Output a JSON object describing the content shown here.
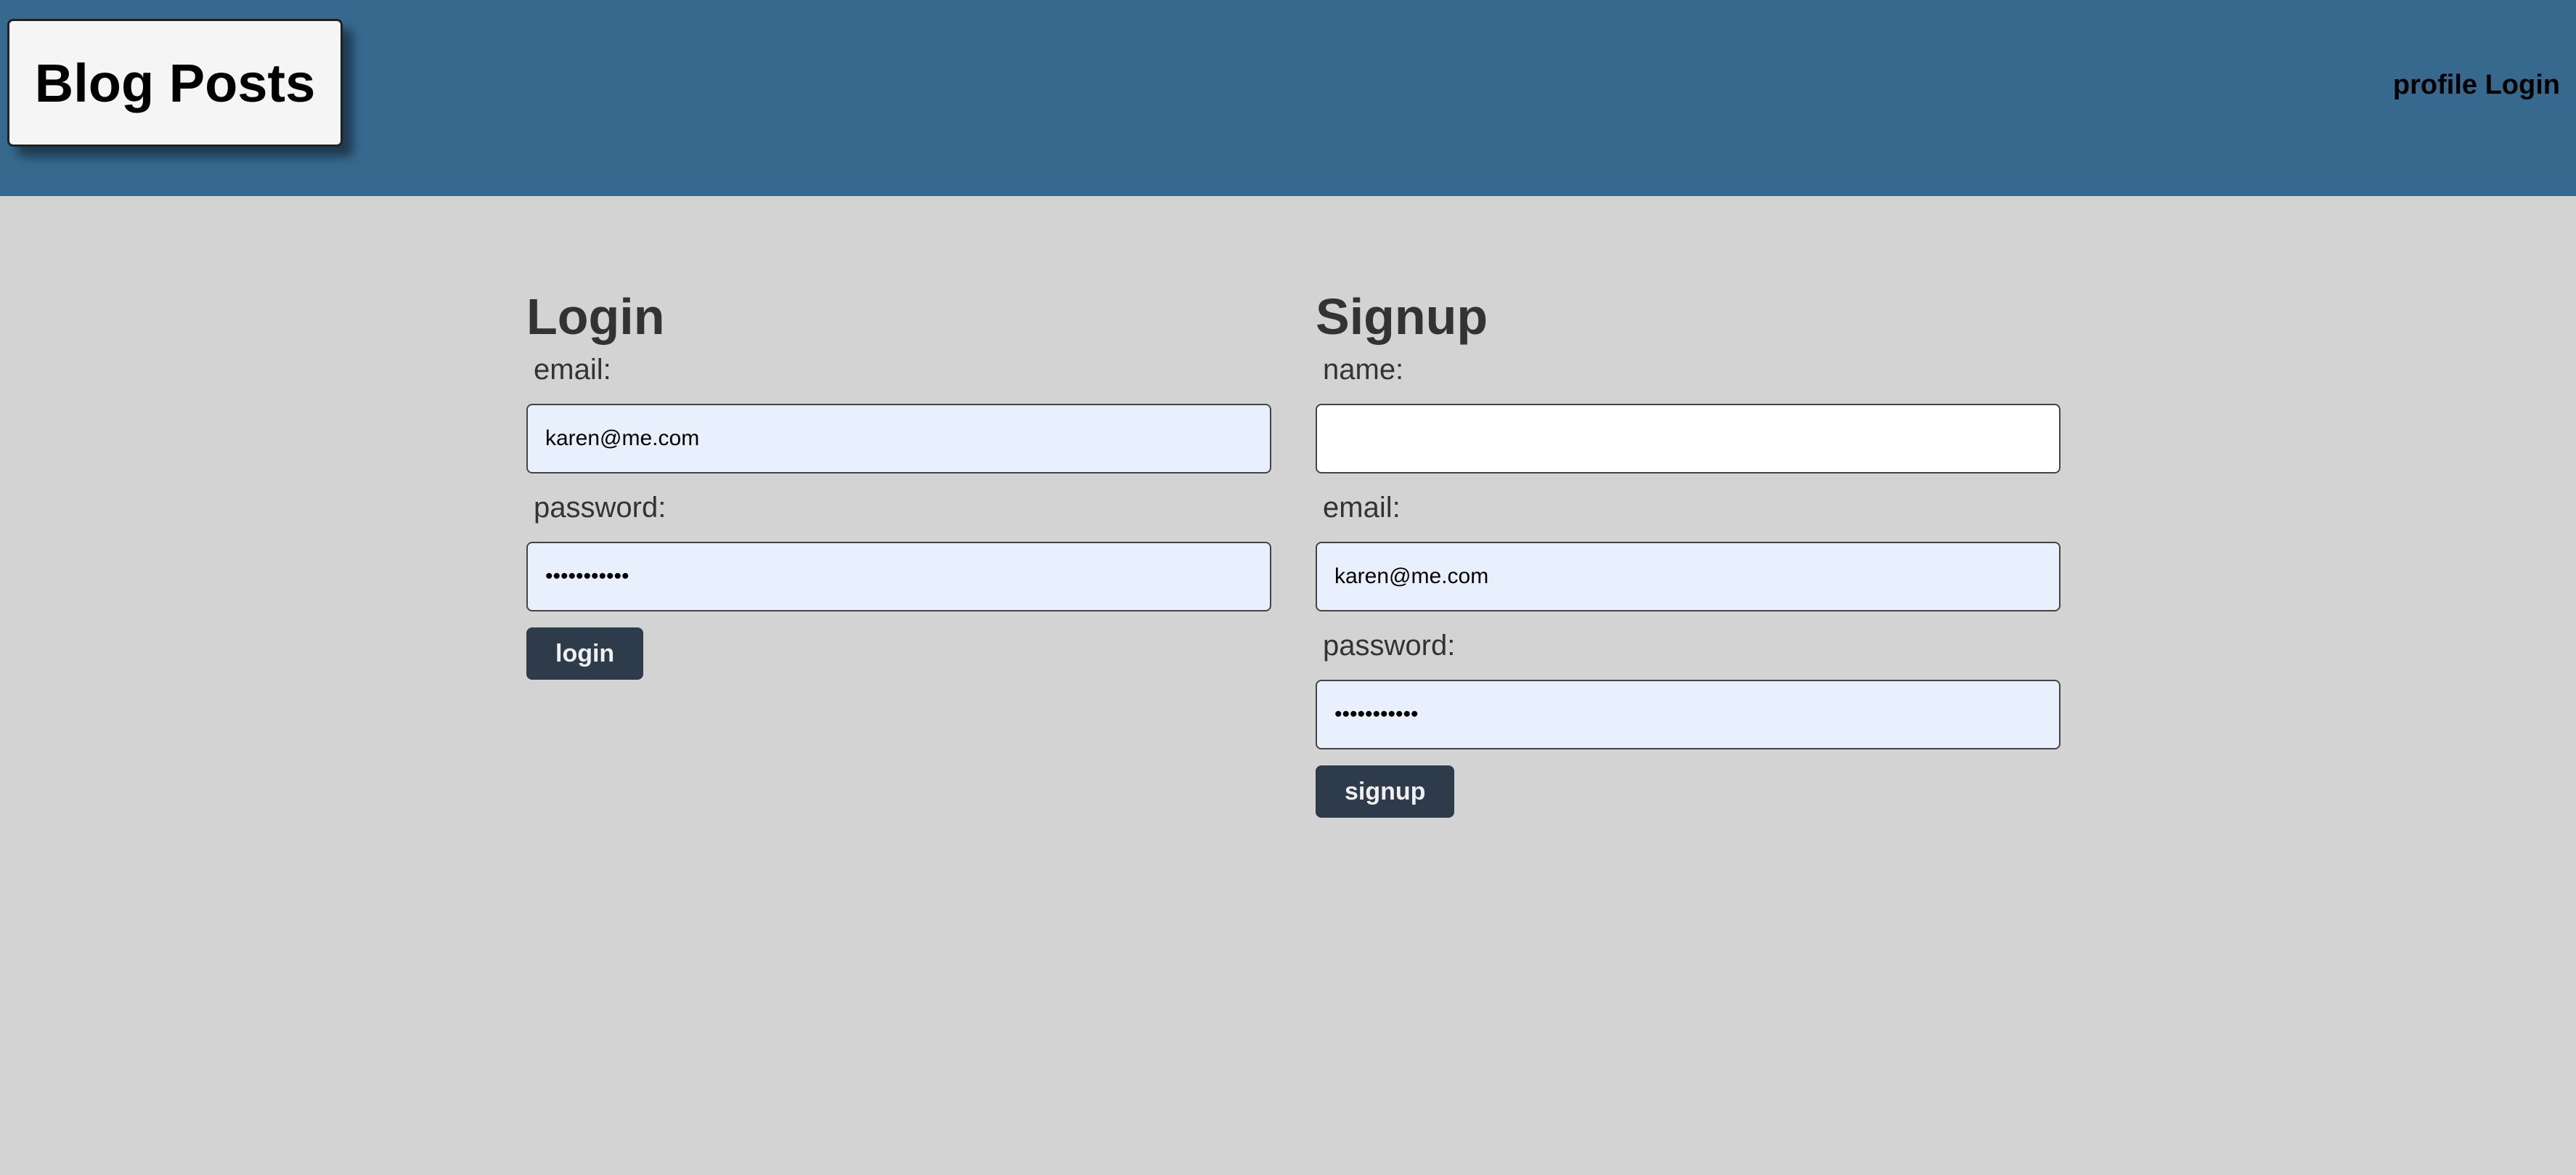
{
  "header": {
    "brand": "Blog Posts",
    "nav": {
      "profile": "profile",
      "login": "Login"
    }
  },
  "login_form": {
    "title": "Login",
    "email_label": "email:",
    "email_value": "karen@me.com",
    "password_label": "password:",
    "password_value": "•••••••••••",
    "submit_label": "login"
  },
  "signup_form": {
    "title": "Signup",
    "name_label": "name:",
    "name_value": "",
    "email_label": "email:",
    "email_value": "karen@me.com",
    "password_label": "password:",
    "password_value": "•••••••••••",
    "submit_label": "signup"
  },
  "colors": {
    "header_bg": "#37698f",
    "page_bg": "#d3d3d3",
    "button_bg": "#2e3b4a",
    "autofill_bg": "#e8f0fe"
  }
}
